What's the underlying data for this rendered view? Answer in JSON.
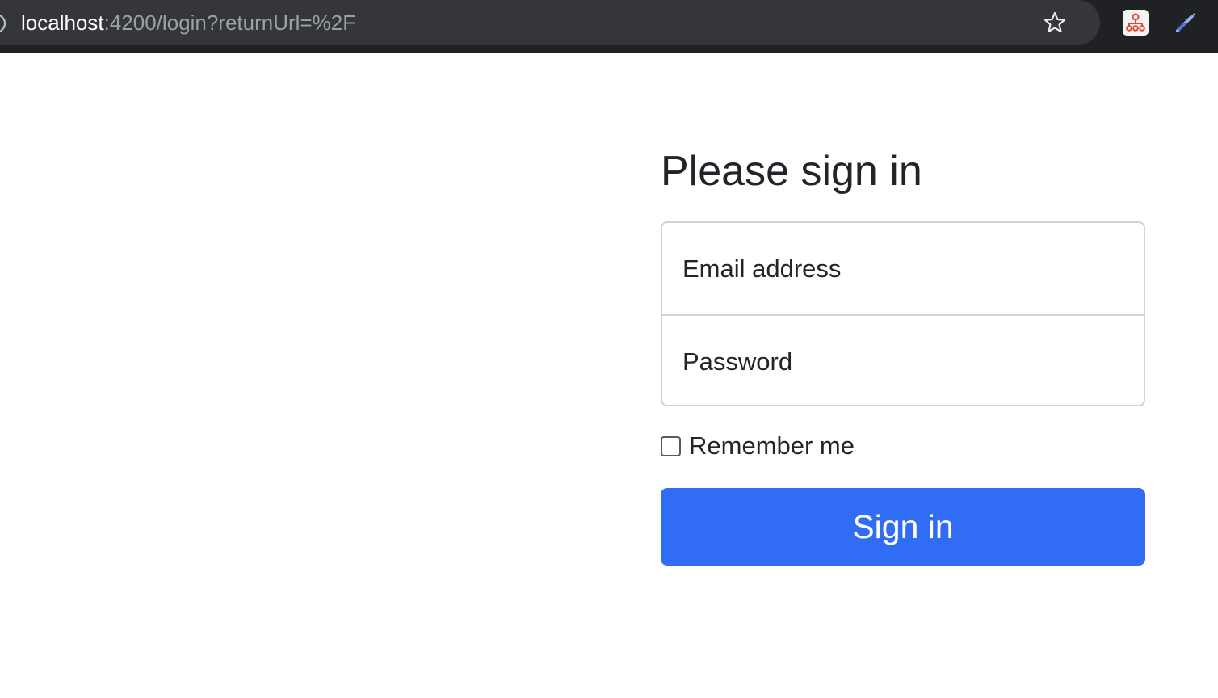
{
  "browser": {
    "url_host": "localhost",
    "url_path": ":4200/login?returnUrl=%2F",
    "icons": {
      "info": "info-icon",
      "bookmark": "star-icon",
      "extension": "sitemap-extension-icon",
      "pen": "pen-icon"
    }
  },
  "signin": {
    "title": "Please sign in",
    "email": {
      "value": "",
      "placeholder": "Email address"
    },
    "password": {
      "value": "",
      "placeholder": "Password"
    },
    "remember_label": "Remember me",
    "remember_checked": false,
    "submit_label": "Sign in"
  },
  "colors": {
    "primary": "#316cf4",
    "text": "#212529",
    "border": "#ced4da",
    "browser_bar": "#202124"
  }
}
